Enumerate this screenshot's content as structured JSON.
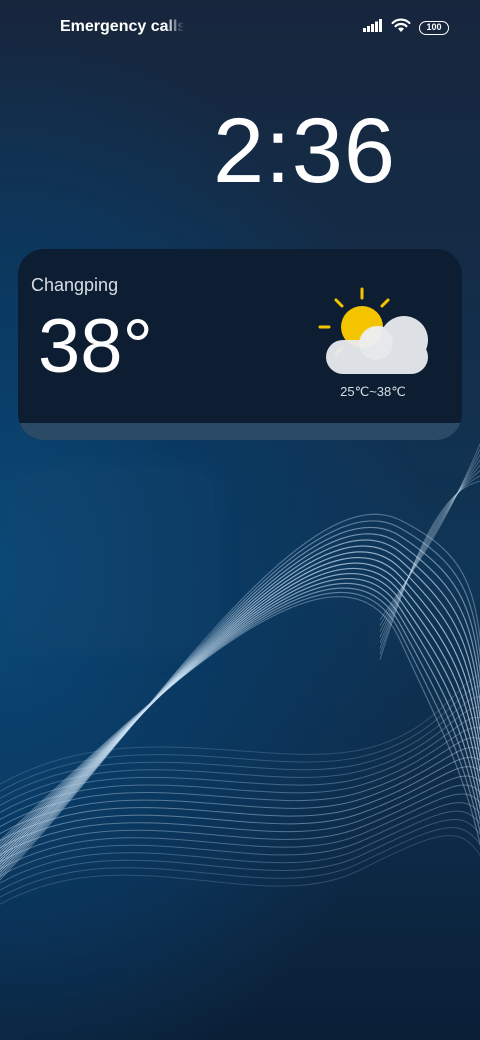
{
  "status_bar": {
    "carrier_text": "Emergency calls only",
    "battery_level": "100",
    "icons": [
      "signal-icon",
      "wifi-icon",
      "battery-icon"
    ]
  },
  "lock_screen": {
    "time": "2:36"
  },
  "weather": {
    "city": "Changping",
    "temperature": "38°",
    "range": "25℃~38℃",
    "condition_icon": "partly-cloudy-icon",
    "colors": {
      "sun": "#f5c400",
      "cloud": "#e9ecef"
    }
  },
  "theme": {
    "background_top": "#17263d",
    "background_mid": "#0f3556",
    "wave_color": "#cfe3f5"
  }
}
